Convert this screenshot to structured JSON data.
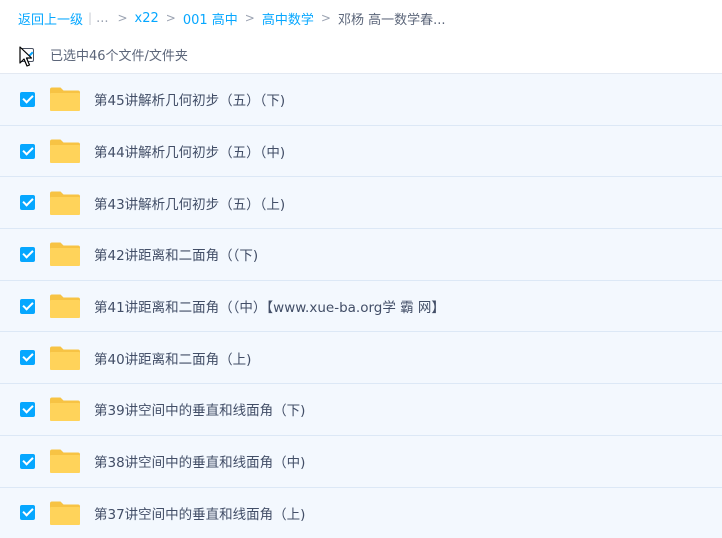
{
  "breadcrumb": {
    "back": "返回上一级",
    "ellipsis": "...",
    "items": [
      "x22",
      "001 高中",
      "高中数学"
    ],
    "current": "邓杨 高一数学春...",
    "separator": ">"
  },
  "selection": {
    "text": "已选中46个文件/文件夹"
  },
  "files": [
    {
      "name": "第45讲解析几何初步（五）（下)"
    },
    {
      "name": "第44讲解析几何初步（五）（中)"
    },
    {
      "name": "第43讲解析几何初步（五）（上)"
    },
    {
      "name": "第42讲距离和二面角（（下)"
    },
    {
      "name": "第41讲距离和二面角（（中）【www.xue-ba.org学 霸 网】"
    },
    {
      "name": "第40讲距离和二面角（上)"
    },
    {
      "name": "第39讲空间中的垂直和线面角（下)"
    },
    {
      "name": "第38讲空间中的垂直和线面角（中)"
    },
    {
      "name": "第37讲空间中的垂直和线面角（上)"
    }
  ],
  "colors": {
    "accent": "#06a7ff",
    "row_bg": "#f3f8fe",
    "folder": "#ffd35a"
  }
}
